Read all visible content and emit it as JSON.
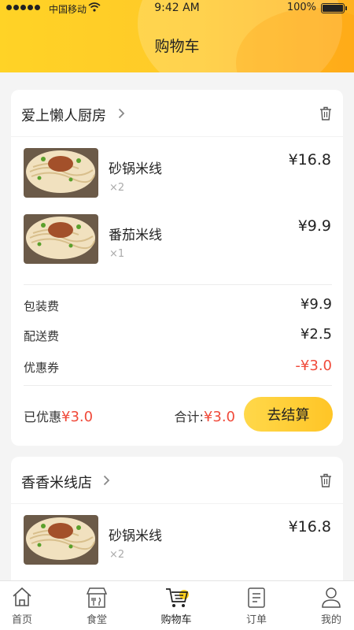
{
  "status_bar": {
    "carrier": "中国移动",
    "time": "9:42 AM",
    "battery": "100%"
  },
  "header": {
    "title": "购物车"
  },
  "shops": [
    {
      "name": "爱上懒人厨房",
      "items": [
        {
          "name": "砂锅米线",
          "qty": "×2",
          "price": "¥16.8"
        },
        {
          "name": "番茄米线",
          "qty": "×1",
          "price": "¥9.9"
        }
      ],
      "fees": [
        {
          "label": "包装费",
          "value": "¥9.9"
        },
        {
          "label": "配送费",
          "value": "¥2.5"
        },
        {
          "label": "优惠券",
          "value": "-¥3.0"
        }
      ],
      "discount_label": "已优惠",
      "discount_value": "¥3.0",
      "total_label": "合计:",
      "total_value": "¥3.0",
      "checkout_label": "去结算"
    },
    {
      "name": "香香米线店",
      "items": [
        {
          "name": "砂锅米线",
          "qty": "×2",
          "price": "¥16.8"
        }
      ]
    }
  ],
  "tabbar": [
    {
      "label": "首页",
      "icon": "home-icon"
    },
    {
      "label": "食堂",
      "icon": "canteen-icon"
    },
    {
      "label": "购物车",
      "icon": "cart-icon"
    },
    {
      "label": "订单",
      "icon": "orders-icon"
    },
    {
      "label": "我的",
      "icon": "profile-icon"
    }
  ],
  "colors": {
    "accent": "#ffc928",
    "price_red": "#f04a3a"
  }
}
